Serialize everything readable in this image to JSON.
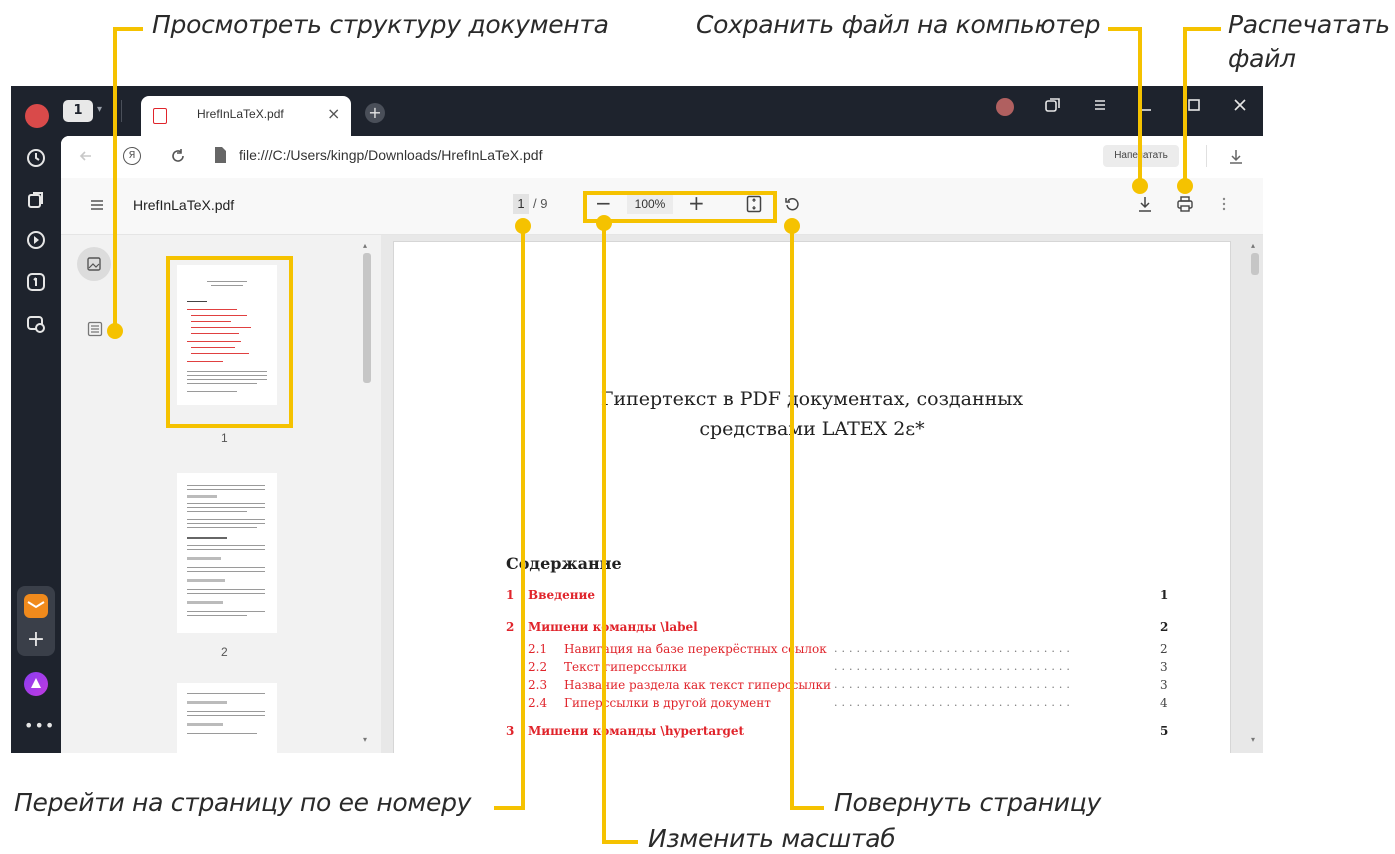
{
  "annotations": {
    "structure": "Просмотреть структуру документа",
    "save": "Сохранить файл на компьютер",
    "print_line1": "Распечатать",
    "print_line2": "файл",
    "goto_page": "Перейти на страницу по ее номеру",
    "zoom": "Изменить масштаб",
    "rotate": "Повернуть страницу"
  },
  "browser": {
    "tab_count": "1",
    "tab_title": "HrefInLaTeX.pdf",
    "tab_close": "×",
    "new_tab": "+",
    "address": "file:///C:/Users/kingp/Downloads/HrefInLaTeX.pdf",
    "print_button": "Напечатать",
    "yandex_badge": "Я"
  },
  "pdf_toolbar": {
    "filename": "HrefInLaTeX.pdf",
    "page_current": "1",
    "page_total": "/ 9",
    "zoom_minus": "−",
    "zoom_value": "100%",
    "zoom_plus": "+"
  },
  "thumbnails": [
    {
      "label": "1"
    },
    {
      "label": "2"
    }
  ],
  "document": {
    "title_line1": "Гипертекст в PDF документах, созданных",
    "title_line2": "средствами LATEX 2ε*",
    "toc_heading": "Содержание",
    "toc": [
      {
        "num": "1",
        "title": "Введение",
        "page": "1",
        "level": 1
      },
      {
        "num": "2",
        "title": "Мишени команды \\label",
        "page": "2",
        "level": 1
      },
      {
        "num": "2.1",
        "title": "Навигация на базе перекрёстных ссылок",
        "page": "2",
        "level": 2
      },
      {
        "num": "2.2",
        "title": "Текст гиперссылки",
        "page": "3",
        "level": 2
      },
      {
        "num": "2.3",
        "title": "Название раздела как текст гиперссылки",
        "page": "3",
        "level": 2
      },
      {
        "num": "2.4",
        "title": "Гиперссылки в другой документ",
        "page": "4",
        "level": 2
      },
      {
        "num": "3",
        "title": "Мишени команды \\hypertarget",
        "page": "5",
        "level": 1
      }
    ]
  },
  "colors": {
    "accent_yellow": "#f5c200",
    "window_dark": "#1e232d",
    "link_red": "#e0242b"
  }
}
